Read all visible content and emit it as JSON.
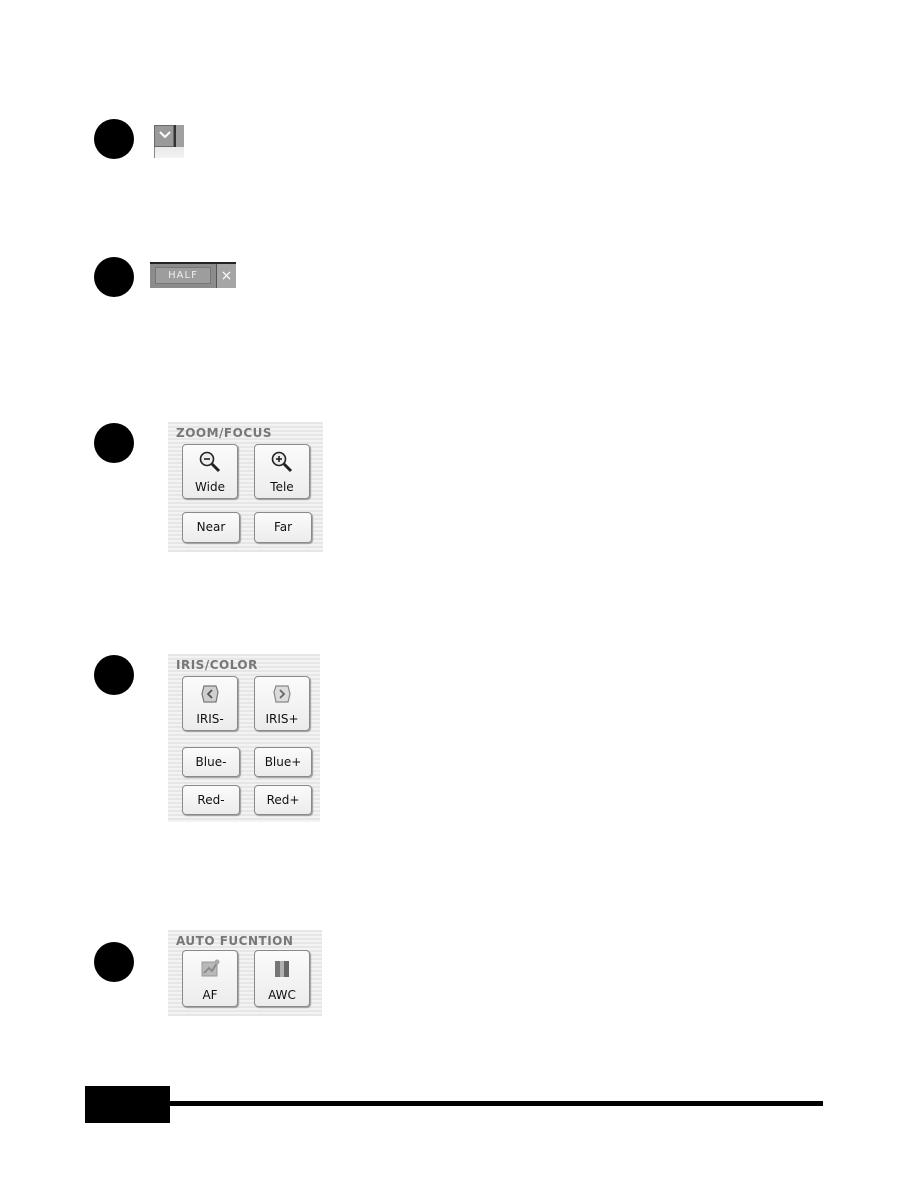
{
  "items": [
    {
      "id": 1,
      "type": "dropdown-toggle",
      "icon": "chevron-down-icon"
    },
    {
      "id": 2,
      "type": "toolbar",
      "half_label": "HALF",
      "close_glyph": "×"
    },
    {
      "id": 3,
      "type": "panel",
      "title": "ZOOM/FOCUS",
      "buttons": [
        {
          "label": "Wide",
          "icon": "zoom-out-icon"
        },
        {
          "label": "Tele",
          "icon": "zoom-in-icon"
        },
        {
          "label": "Near"
        },
        {
          "label": "Far"
        }
      ]
    },
    {
      "id": 4,
      "type": "panel",
      "title": "IRIS/COLOR",
      "buttons": [
        {
          "label": "IRIS-",
          "icon": "iris-close-icon"
        },
        {
          "label": "IRIS+",
          "icon": "iris-open-icon"
        },
        {
          "label": "Blue-"
        },
        {
          "label": "Blue+"
        },
        {
          "label": "Red-"
        },
        {
          "label": "Red+"
        }
      ]
    },
    {
      "id": 5,
      "type": "panel",
      "title": "AUTO FUCNTION",
      "buttons": [
        {
          "label": "AF",
          "icon": "auto-focus-icon"
        },
        {
          "label": "AWC",
          "icon": "auto-white-balance-icon"
        }
      ]
    }
  ],
  "chevron_glyph": "⌄"
}
